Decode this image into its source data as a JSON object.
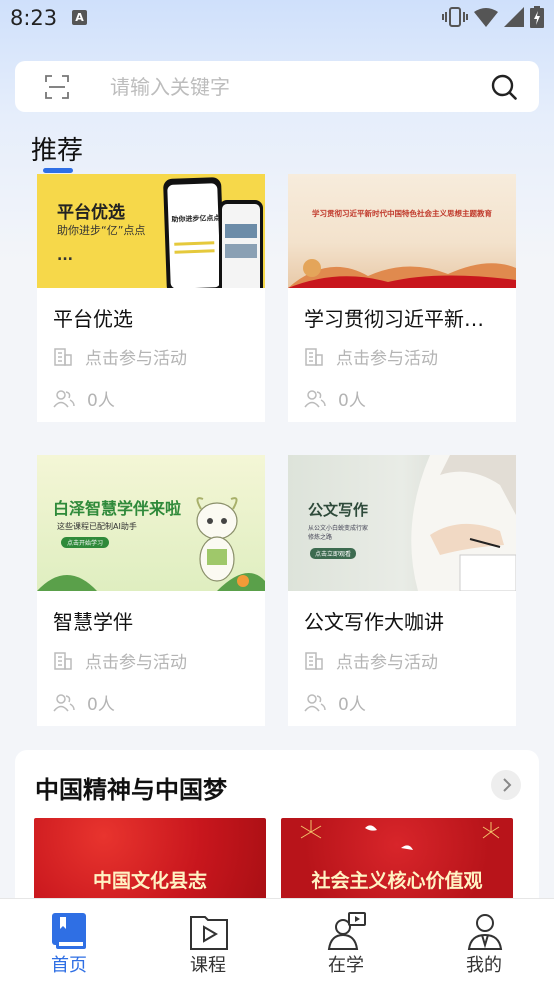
{
  "status_bar": {
    "time": "8:23",
    "notif_icon": "A"
  },
  "search": {
    "placeholder": "请输入关键字"
  },
  "recommend": {
    "title": "推荐",
    "cards": [
      {
        "title": "平台优选",
        "meta": "点击参与活动",
        "count": "0人",
        "thumb": {
          "heading": "平台优选",
          "sub": "助你进步“亿”点点",
          "dots": "...",
          "phone_text": "助你进步亿点点"
        }
      },
      {
        "title": "学习贯彻习近平新…",
        "meta": "点击参与活动",
        "count": "0人",
        "thumb": {
          "heading": "学习贯彻习近平新时代中国特色社会主义思想主题教育"
        }
      },
      {
        "title": "智慧学伴",
        "meta": "点击参与活动",
        "count": "0人",
        "thumb": {
          "heading": "白泽智慧学伴来啦",
          "sub": "这些课程已配制AI助手",
          "btn": "点击开始学习"
        }
      },
      {
        "title": "公文写作大咖讲",
        "meta": "点击参与活动",
        "count": "0人",
        "thumb": {
          "heading": "公文写作",
          "sub": "从公文小白蜕变成行家",
          "sub2": "修炼之路",
          "btn": "点击立即观看"
        }
      }
    ]
  },
  "section": {
    "title": "中国精神与中国梦",
    "banners": [
      {
        "text": "中国文化县志"
      },
      {
        "text": "社会主义核心价值观"
      }
    ]
  },
  "tabbar": {
    "items": [
      {
        "label": "首页",
        "active": true
      },
      {
        "label": "课程",
        "active": false
      },
      {
        "label": "在学",
        "active": false
      },
      {
        "label": "我的",
        "active": false
      }
    ]
  },
  "colors": {
    "accent": "#2f6fe4",
    "card_yellow": "#f6d84a",
    "banner_red": "#c8161d"
  }
}
